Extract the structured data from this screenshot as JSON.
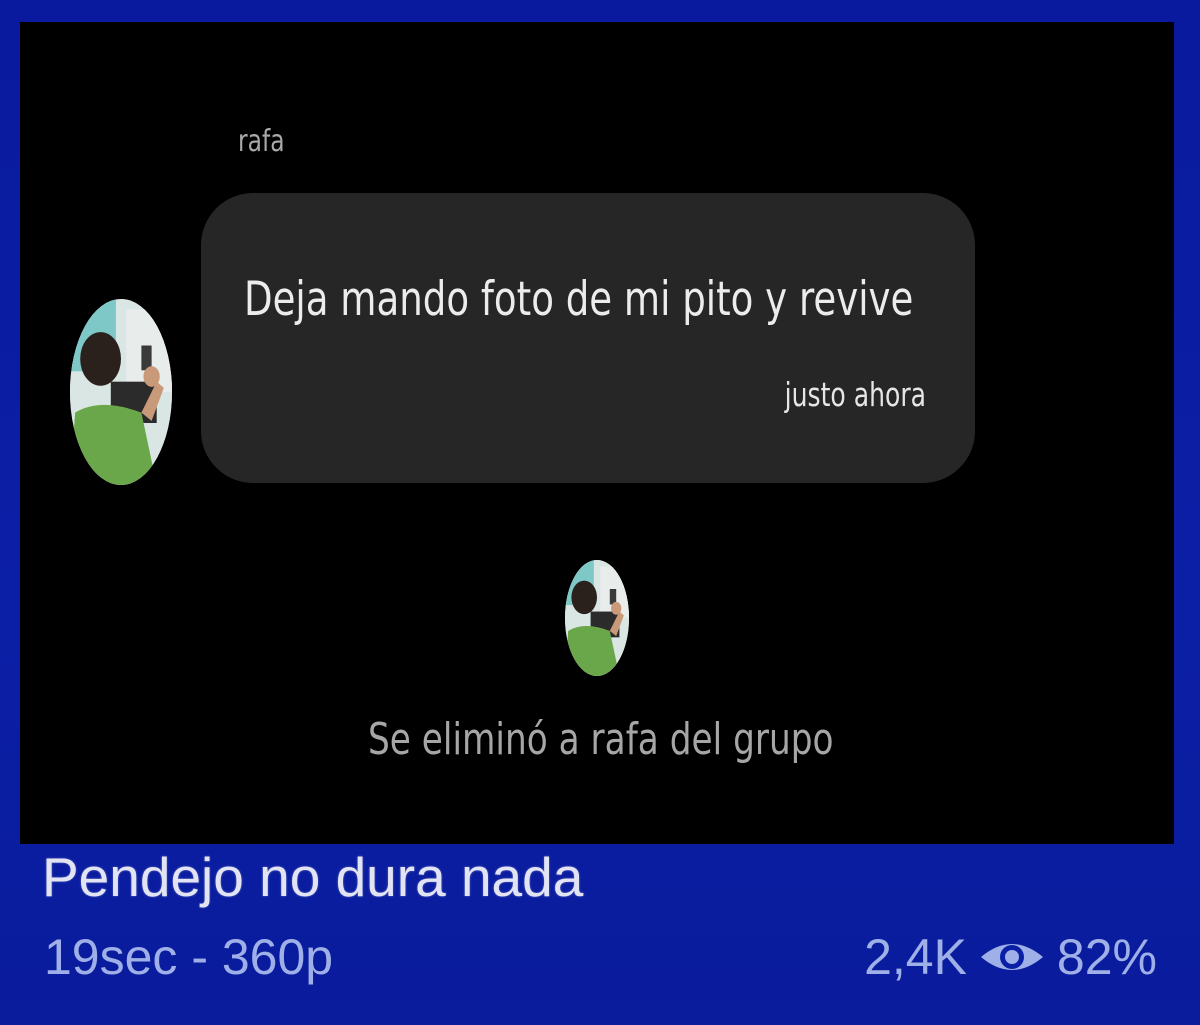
{
  "chat": {
    "sender_name": "rafa",
    "message": {
      "text": "Deja mando foto de mi pito y revive",
      "time": "justo ahora"
    },
    "system_message": "Se eliminó a rafa del grupo"
  },
  "video": {
    "title": "Pendejo no dura nada",
    "meta": "19sec - 360p",
    "views": "2,4K",
    "rating": "82%",
    "views_icon": "eye-icon"
  },
  "colors": {
    "frame": "#0b1a9a",
    "chat_background": "#000000",
    "bubble": "#262626",
    "meta_text": "#9fb0e8"
  }
}
